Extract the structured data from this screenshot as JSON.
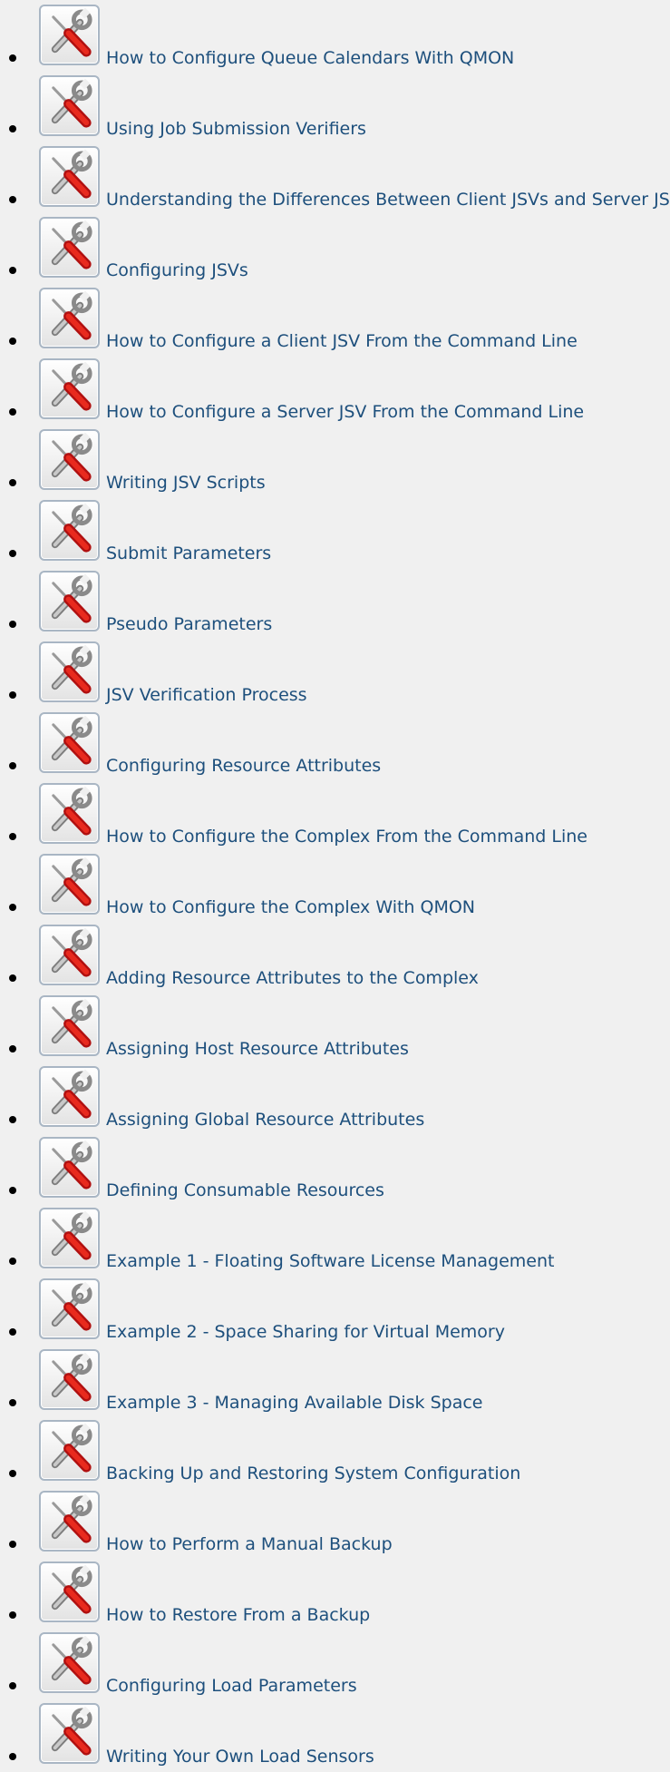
{
  "icon": {
    "name": "tools-icon"
  },
  "topics": [
    {
      "label": "How to Configure Queue Calendars With QMON"
    },
    {
      "label": "Using Job Submission Verifiers"
    },
    {
      "label": "Understanding the Differences Between Client JSVs and Server JSVs"
    },
    {
      "label": "Configuring JSVs"
    },
    {
      "label": "How to Configure a Client JSV From the Command Line"
    },
    {
      "label": "How to Configure a Server JSV From the Command Line"
    },
    {
      "label": "Writing JSV Scripts"
    },
    {
      "label": "Submit Parameters"
    },
    {
      "label": "Pseudo Parameters"
    },
    {
      "label": "JSV Verification Process"
    },
    {
      "label": "Configuring Resource Attributes"
    },
    {
      "label": "How to Configure the Complex From the Command Line"
    },
    {
      "label": "How to Configure the Complex With QMON"
    },
    {
      "label": "Adding Resource Attributes to the Complex"
    },
    {
      "label": "Assigning Host Resource Attributes"
    },
    {
      "label": "Assigning Global Resource Attributes"
    },
    {
      "label": "Defining Consumable Resources"
    },
    {
      "label": "Example 1 - Floating Software License Management"
    },
    {
      "label": "Example 2 - Space Sharing for Virtual Memory"
    },
    {
      "label": "Example 3 - Managing Available Disk Space"
    },
    {
      "label": "Backing Up and Restoring System Configuration"
    },
    {
      "label": "How to Perform a Manual Backup"
    },
    {
      "label": "How to Restore From a Backup"
    },
    {
      "label": "Configuring Load Parameters"
    },
    {
      "label": "Writing Your Own Load Sensors"
    }
  ]
}
